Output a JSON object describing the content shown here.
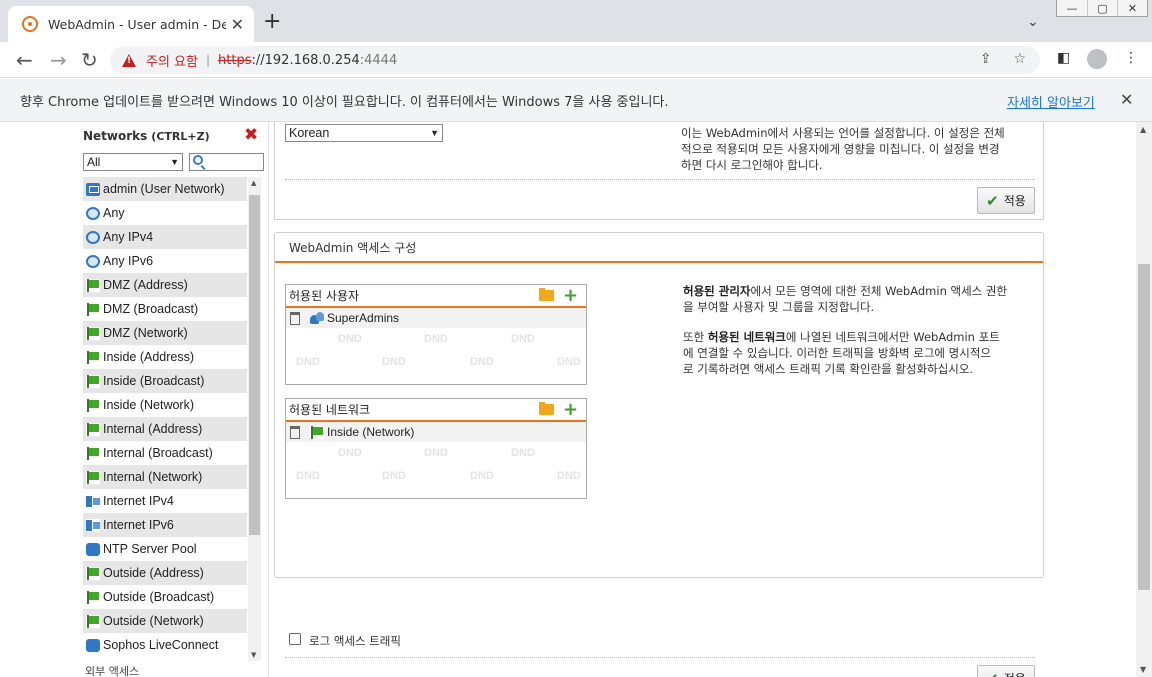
{
  "browser": {
    "tab_title": "WebAdmin - User admin - Devi",
    "tab_close": "✕",
    "new_tab": "+",
    "tab_list": "⌄",
    "window_controls": [
      "—",
      "▢",
      "✕"
    ],
    "back": "←",
    "forward": "→",
    "reload": "↻",
    "security_warning": "주의 요함",
    "url_scheme": "https",
    "url_host": "://192.168.0.254",
    "url_port": ":4444",
    "share_icon": "⇪",
    "bookmark_icon": "☆",
    "sidepanel_icon": "◧",
    "menu_icon": "⋮"
  },
  "infobar": {
    "message": "향후 Chrome 업데이트를 받으려면 Windows 10 이상이 필요합니다. 이 컴퓨터에서는 Windows 7을 사용 중입니다.",
    "link": "자세히 알아보기",
    "close": "✕"
  },
  "left_panel": {
    "title": "Networks",
    "shortcut": "(CTRL+Z)",
    "close": "✖",
    "filter_value": "All",
    "items": [
      {
        "label": "admin (User Network)",
        "icon": "host"
      },
      {
        "label": "Any",
        "icon": "globe"
      },
      {
        "label": "Any IPv4",
        "icon": "globe"
      },
      {
        "label": "Any IPv6",
        "icon": "globe"
      },
      {
        "label": "DMZ (Address)",
        "icon": "flag"
      },
      {
        "label": "DMZ (Broadcast)",
        "icon": "flag"
      },
      {
        "label": "DMZ (Network)",
        "icon": "flag"
      },
      {
        "label": "Inside (Address)",
        "icon": "flag"
      },
      {
        "label": "Inside (Broadcast)",
        "icon": "flag"
      },
      {
        "label": "Inside (Network)",
        "icon": "flag"
      },
      {
        "label": "Internal (Address)",
        "icon": "flag"
      },
      {
        "label": "Internal (Broadcast)",
        "icon": "flag"
      },
      {
        "label": "Internal (Network)",
        "icon": "flag"
      },
      {
        "label": "Internet IPv4",
        "icon": "net"
      },
      {
        "label": "Internet IPv6",
        "icon": "net"
      },
      {
        "label": "NTP Server Pool",
        "icon": "svc"
      },
      {
        "label": "Outside (Address)",
        "icon": "flag"
      },
      {
        "label": "Outside (Broadcast)",
        "icon": "flag"
      },
      {
        "label": "Outside (Network)",
        "icon": "flag"
      },
      {
        "label": "Sophos LiveConnect",
        "icon": "svc"
      }
    ],
    "footer_partial": "외부 액세스"
  },
  "language": {
    "selected": "Korean",
    "description_lines": [
      "이는 WebAdmin에서 사용되는 언어를 설정합니다. 이 설정은 전체",
      "적으로 적용되며 모든 사용자에게 영향을 미칩니다. 이 설정을 변경",
      "하면 다시 로그인해야 합니다."
    ],
    "apply_label": "적용"
  },
  "access": {
    "section_title": "WebAdmin 액세스 구성",
    "allowed_users_title": "허용된 사용자",
    "allowed_users": [
      "SuperAdmins"
    ],
    "allowed_networks_title": "허용된 네트워크",
    "allowed_networks": [
      "Inside (Network)"
    ],
    "dnd_label": "DND",
    "desc1_bold": "허용된 관리자",
    "desc1_rest": "에서 모든 영역에 대한 전체 WebAdmin 액세스 권한",
    "desc1_line2": "을 부여할 사용자 및 그룹을 지정합니다.",
    "desc2_pre": "또한 ",
    "desc2_bold": "허용된 네트워크",
    "desc2_rest": "에 나열된 네트워크에서만 WebAdmin 포트",
    "desc2_line2": "에 연결할 수 있습니다. 이러한 트래픽을 방화벽 로그에 명시적으",
    "desc2_line3": "로 기록하려면 액세스 트래픽 기록 확인란을 활성화하십시오.",
    "log_checkbox_label": "로그 액세스 트래픽",
    "log_checked": false,
    "apply_label": "적용"
  }
}
